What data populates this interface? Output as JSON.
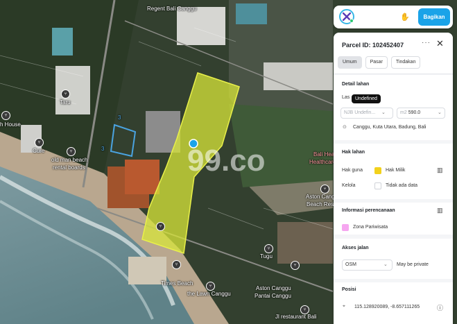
{
  "map": {
    "labels": {
      "regent": "Regent Bali Canggu",
      "taru": "Taru",
      "house": "h House",
      "cure": "Cure",
      "oldman1": "old man beach",
      "oldman2": "rental boards",
      "bali_hea": "Bali Hea",
      "healthcare": "Healthcare",
      "aston_beach1": "Aston Canggu",
      "aston_beach2": "Beach Res",
      "tugu": "Tugu",
      "times": "Times Beach",
      "lawn": "the Lawn Canggu",
      "aston_pantai1": "Aston Canggu",
      "aston_pantai2": "Pantai Canggu",
      "jl_restaurant": "Jl restaurant Bali",
      "watermark": "99.co",
      "parcel_no1": "3",
      "parcel_no2": "3"
    },
    "colors": {
      "parcel": "#d8e53a",
      "parcel_blue": "#4aa3e0"
    }
  },
  "topbar": {
    "share_label": "Bagikan",
    "logo_icon": "app-logo-icon",
    "hand_icon": "hand-icon"
  },
  "panel": {
    "title": "Parcel ID: 102452407",
    "more": "···",
    "close": "✕",
    "tabs": [
      "Umum",
      "Pasar",
      "Tindakan"
    ],
    "detail": {
      "heading": "Detail lahan",
      "luas_label": "Las",
      "tooltip": "Undefined",
      "nib_prefix": "NJB",
      "nib_value": "Undefin...",
      "m2_prefix": "m2",
      "area_value": "590.0",
      "address": "Canggu, Kuta Utara, Badung, Bali"
    },
    "hak": {
      "heading": "Hak lahan",
      "hak_guna_label": "Hak guna",
      "hak_guna_value": "Hak Milik",
      "hak_guna_color": "#f2d11c",
      "kelola_label": "Kelola",
      "kelola_value": "Tidak ada data"
    },
    "perencanaan": {
      "heading": "Informasi perencanaan",
      "zona": "Zona Pariwisata",
      "zona_color": "#f6a6f0"
    },
    "akses": {
      "heading": "Akses jalan",
      "select_value": "OSM",
      "note": "May be private"
    },
    "posisi": {
      "heading": "Posisi",
      "coords": "115.128920089, -8.657111265"
    }
  }
}
